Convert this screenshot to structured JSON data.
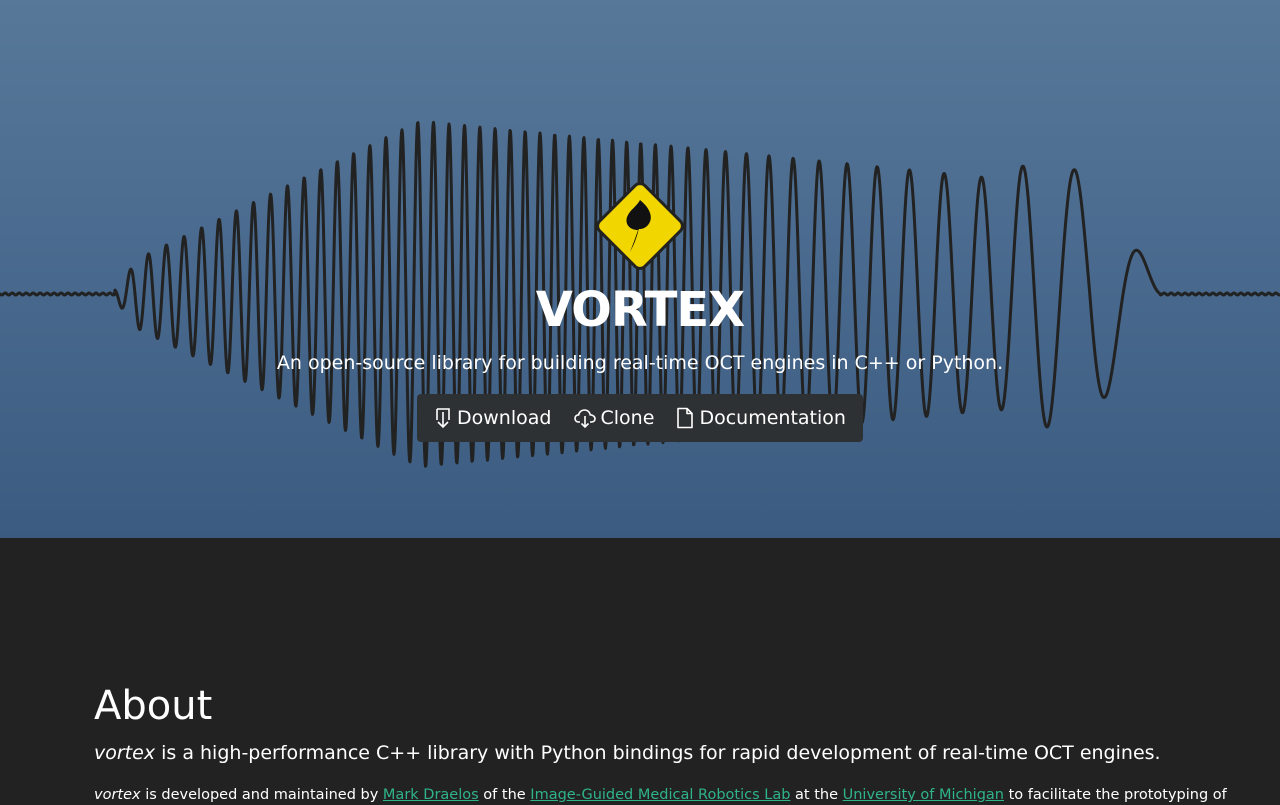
{
  "hero": {
    "title": "VORTEX",
    "tagline": "An open-source library for building real-time OCT engines in C++ or Python.",
    "buttons": {
      "download": "Download",
      "clone": "Clone",
      "documentation": "Documentation"
    }
  },
  "about": {
    "heading": "About",
    "lead_name": "vortex",
    "lead_rest": " is a high-performance C++ library with Python bindings for rapid development of real-time OCT engines.",
    "para": {
      "name": "vortex",
      "t1": " is developed and maintained by ",
      "link1": "Mark Draelos",
      "t2": " of the ",
      "link2": "Image-Guided Medical Robotics Lab",
      "t3": " at the ",
      "link3": "University of Michigan",
      "t4": " to facilitate the prototyping of"
    }
  },
  "colors": {
    "hero_top": "#577898",
    "hero_bottom": "#3b5c80",
    "page_bg": "#222222",
    "logo_yellow": "#f2d600",
    "link": "#2fb38a",
    "button_bar": "#2e3133"
  },
  "icons": {
    "logo": "vortex-diamond-logo",
    "download": "download-icon",
    "clone": "cloud-download-icon",
    "documentation": "document-icon"
  }
}
